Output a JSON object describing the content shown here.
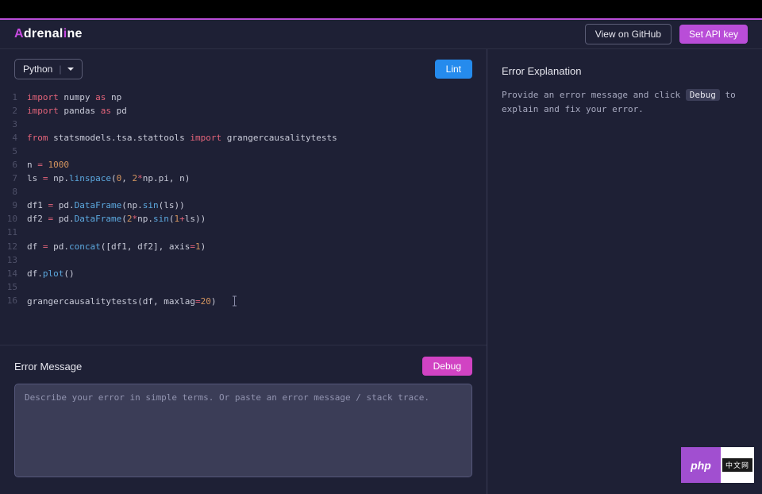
{
  "logo": {
    "a": "A",
    "mid1": "drenal",
    "i": "i",
    "mid2": "ne"
  },
  "header": {
    "github": "View on GitHub",
    "api_key": "Set API key"
  },
  "toolbar": {
    "language": "Python",
    "lint": "Lint"
  },
  "code": {
    "lines": [
      {
        "n": "1"
      },
      {
        "n": "2"
      },
      {
        "n": "3"
      },
      {
        "n": "4"
      },
      {
        "n": "5"
      },
      {
        "n": "6"
      },
      {
        "n": "7"
      },
      {
        "n": "8"
      },
      {
        "n": "9"
      },
      {
        "n": "10"
      },
      {
        "n": "11"
      },
      {
        "n": "12"
      },
      {
        "n": "13"
      },
      {
        "n": "14"
      },
      {
        "n": "15"
      },
      {
        "n": "16"
      }
    ],
    "tokens": {
      "import1": "import",
      "numpy": "numpy",
      "as1": "as",
      "np": "np",
      "import2": "import",
      "pandas": "pandas",
      "as2": "as",
      "pd": "pd",
      "from": "from",
      "statsmodels": "statsmodels",
      "tsa": "tsa",
      "stattools": "stattools",
      "import3": "import",
      "gct": "grangercausalitytests",
      "n_var": "n",
      "eq1": "=",
      "thousand": "1000",
      "ls": "ls",
      "eq2": "=",
      "np2": "np",
      "linspace": "linspace",
      "zero": "0",
      "two": "2",
      "star1": "*",
      "np3": "np",
      "pi": "pi",
      "n2": "n",
      "df1": "df1",
      "eq3": "=",
      "pd2": "pd",
      "dataframe1": "DataFrame",
      "np4": "np",
      "sin1": "sin",
      "ls2": "ls",
      "df2": "df2",
      "eq4": "=",
      "pd3": "pd",
      "dataframe2": "DataFrame",
      "two2": "2",
      "star2": "*",
      "np5": "np",
      "sin2": "sin",
      "one": "1",
      "plus": "+",
      "ls3": "ls",
      "df": "df",
      "eq5": "=",
      "pd4": "pd",
      "concat": "concat",
      "df1b": "df1",
      "df2b": "df2",
      "axis": "axis",
      "eq6": "=",
      "one2": "1",
      "df3": "df",
      "plot": "plot",
      "gct2": "grangercausalitytests",
      "df4": "df",
      "maxlag": "maxlag",
      "eq7": "=",
      "twenty": "20"
    }
  },
  "error": {
    "title": "Error Message",
    "debug": "Debug",
    "placeholder": "Describe your error in simple terms. Or paste an error message / stack trace."
  },
  "explanation": {
    "title": "Error Explanation",
    "pre": "Provide an error message and click ",
    "cmd": "Debug",
    "post": " to explain and fix your error."
  },
  "badge": {
    "php": "php",
    "cn": "中文网"
  }
}
